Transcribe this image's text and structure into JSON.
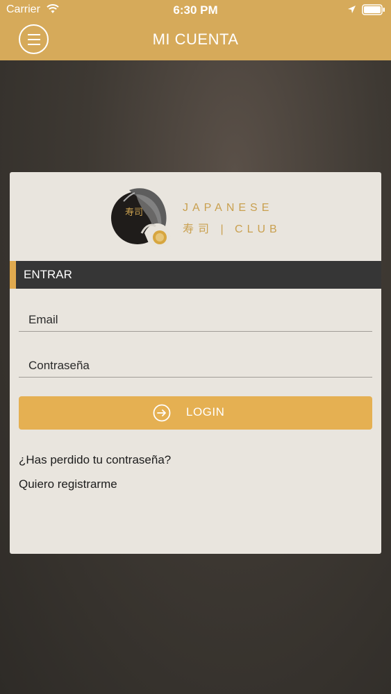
{
  "status_bar": {
    "carrier": "Carrier",
    "time": "6:30 PM",
    "wifi_icon": "wifi-icon",
    "location_icon": "location-arrow-icon",
    "battery_icon": "battery-icon"
  },
  "header": {
    "title": "MI CUENTA",
    "menu_icon": "hamburger-menu-icon",
    "background_color": "#d6aa5a"
  },
  "logo": {
    "emblem": "koi-fish-emblem",
    "emblem_kanji": "寿司",
    "line1": "JAPANESE",
    "line2": "寿司 | CLUB",
    "color": "#c9a04f"
  },
  "login_section": {
    "title": "ENTRAR",
    "email_placeholder": "Email",
    "password_placeholder": "Contraseña",
    "login_label": "LOGIN",
    "login_icon": "arrow-right-circle-icon",
    "forgot_password": "¿Has perdido tu contraseña?",
    "register": "Quiero registrarme",
    "accent_color": "#e5b052"
  }
}
